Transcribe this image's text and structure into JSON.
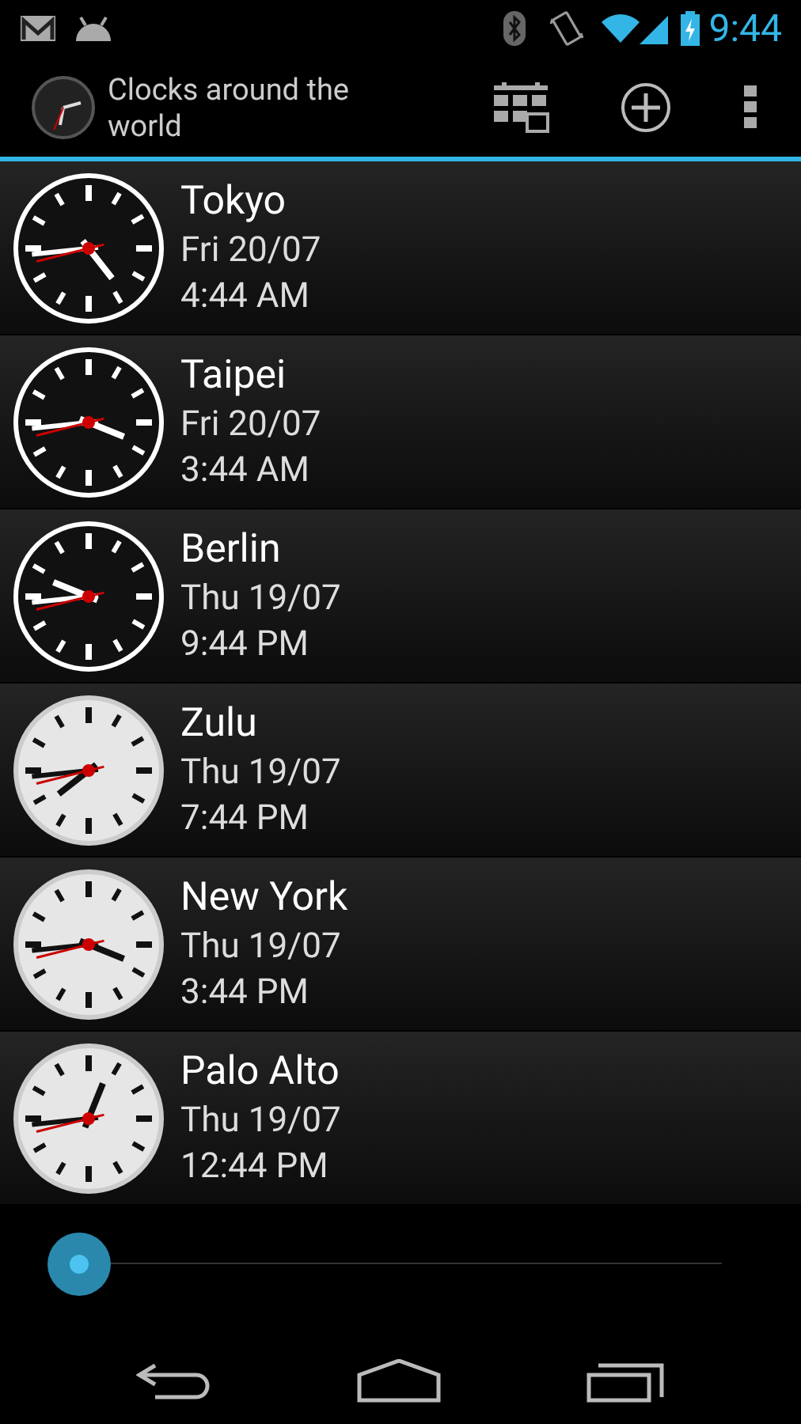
{
  "status_bar": {
    "time": "9:44"
  },
  "action_bar": {
    "title": "Clocks around the world"
  },
  "clocks": [
    {
      "city": "Tokyo",
      "date": "Fri 20/07",
      "time": "4:44 AM",
      "night": true
    },
    {
      "city": "Taipei",
      "date": "Fri 20/07",
      "time": "3:44 AM",
      "night": true
    },
    {
      "city": "Berlin",
      "date": "Thu 19/07",
      "time": "9:44 PM",
      "night": true
    },
    {
      "city": "Zulu",
      "date": "Thu 19/07",
      "time": "7:44 PM",
      "night": false
    },
    {
      "city": "New York",
      "date": "Thu 19/07",
      "time": "3:44 PM",
      "night": false
    },
    {
      "city": "Palo Alto",
      "date": "Thu 19/07",
      "time": "12:44 PM",
      "night": false
    }
  ]
}
